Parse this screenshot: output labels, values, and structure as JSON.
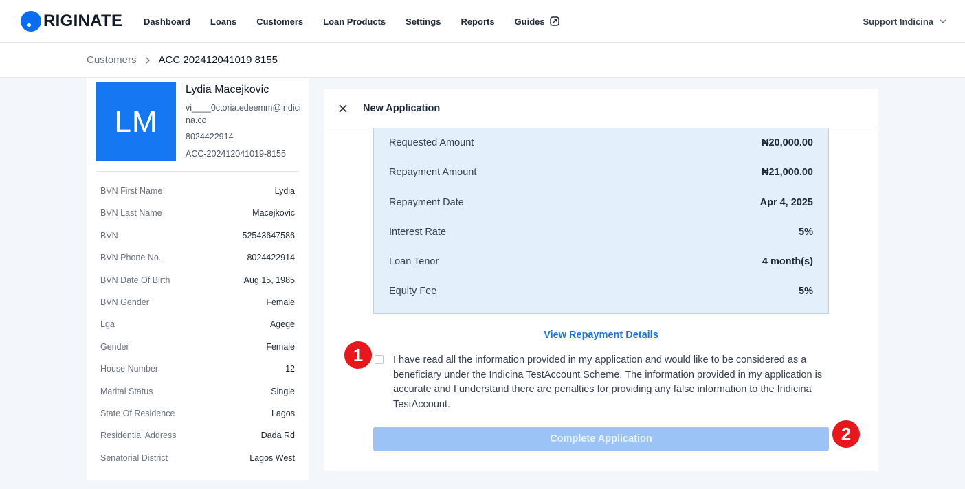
{
  "brand": {
    "name": "RIGINATE",
    "accent": "#0a6cf1"
  },
  "nav": {
    "items": [
      {
        "label": "Dashboard"
      },
      {
        "label": "Loans"
      },
      {
        "label": "Customers"
      },
      {
        "label": "Loan Products"
      },
      {
        "label": "Settings"
      },
      {
        "label": "Reports"
      },
      {
        "label": "Guides"
      }
    ],
    "guides_icon": "external-link-icon",
    "user_label": "Support Indicina"
  },
  "breadcrumb": {
    "parent": "Customers",
    "current": "ACC 202412041019 8155"
  },
  "profile": {
    "initials": "LM",
    "name": "Lydia Macejkovic",
    "email": "vi____0ctoria.edeemm@indicina.co",
    "phone": "8024422914",
    "account": "ACC-202412041019-8155",
    "details": [
      {
        "label": "BVN First Name",
        "value": "Lydia"
      },
      {
        "label": "BVN Last Name",
        "value": "Macejkovic"
      },
      {
        "label": "BVN",
        "value": "52543647586"
      },
      {
        "label": "BVN Phone No.",
        "value": "8024422914"
      },
      {
        "label": "BVN Date Of Birth",
        "value": "Aug 15, 1985"
      },
      {
        "label": "BVN Gender",
        "value": "Female"
      },
      {
        "label": "Lga",
        "value": "Agege"
      },
      {
        "label": "Gender",
        "value": "Female"
      },
      {
        "label": "House Number",
        "value": "12"
      },
      {
        "label": "Marital Status",
        "value": "Single"
      },
      {
        "label": "State Of Residence",
        "value": "Lagos"
      },
      {
        "label": "Residential Address",
        "value": "Dada Rd"
      },
      {
        "label": "Senatorial District",
        "value": "Lagos West"
      }
    ]
  },
  "application": {
    "title": "New Application",
    "summary": [
      {
        "label": "Requested Amount",
        "value": "₦20,000.00"
      },
      {
        "label": "Repayment Amount",
        "value": "₦21,000.00"
      },
      {
        "label": "Repayment Date",
        "value": "Apr 4, 2025"
      },
      {
        "label": "Interest Rate",
        "value": "5%"
      },
      {
        "label": "Loan Tenor",
        "value": "4 month(s)"
      },
      {
        "label": "Equity Fee",
        "value": "5%"
      }
    ],
    "view_repayment_label": "View Repayment Details",
    "consent_text": "I have read all the information provided in my application and would like to be considered as a beneficiary under the Indicina TestAccount Scheme. The information provided in my application is accurate and I understand there are penalties for providing any false information to the Indicina TestAccount.",
    "consent_checked": false,
    "complete_label": "Complete Application"
  },
  "markers": [
    {
      "label": "1"
    },
    {
      "label": "2"
    }
  ],
  "colors": {
    "marker": "#e8171b",
    "summary_bg": "#e4effc",
    "button_disabled": "#9cc3f5",
    "link": "#1a73e8"
  }
}
